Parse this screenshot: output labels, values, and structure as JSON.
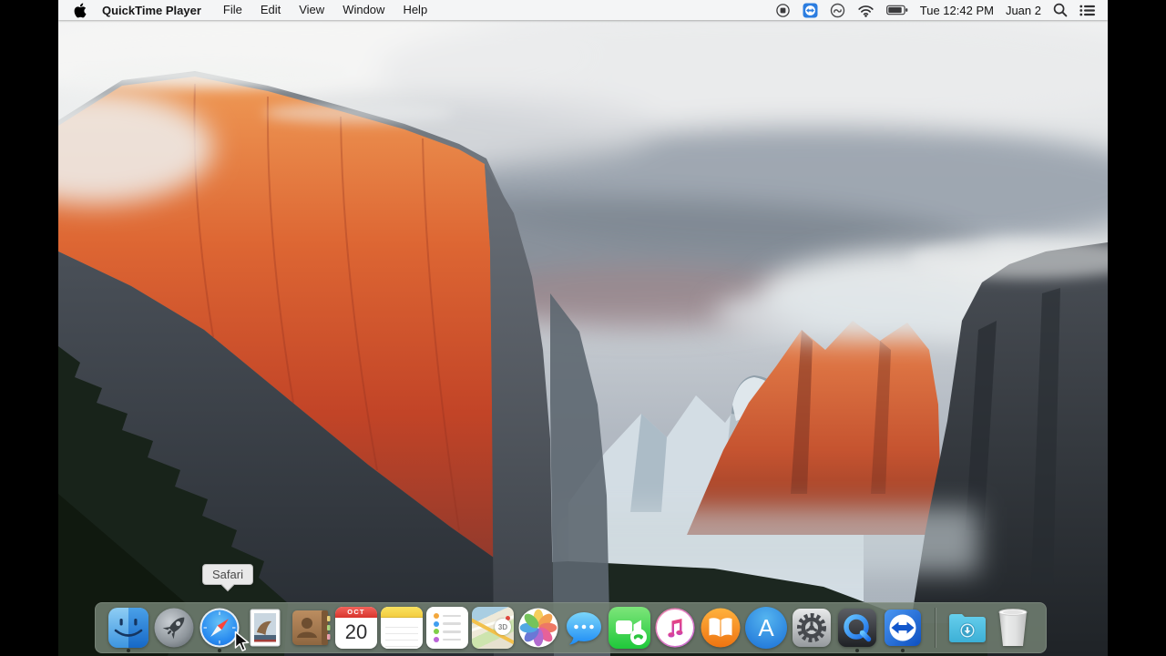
{
  "menu_bar": {
    "app_name": "QuickTime Player",
    "menus": [
      "File",
      "Edit",
      "View",
      "Window",
      "Help"
    ],
    "clock": "Tue 12:42 PM",
    "user_name": "Juan 2",
    "status_icons": [
      "stop-recording-icon",
      "teamviewer-icon",
      "creative-cloud-icon",
      "wifi-icon",
      "battery-icon",
      "spotlight-search-icon",
      "notification-center-icon"
    ],
    "battery_level": 0.85
  },
  "desktop": {
    "wallpaper_name": "os-x-el-capitan-yosemite-valley"
  },
  "tooltip": {
    "text": "Safari"
  },
  "dock": {
    "items": [
      {
        "id": "finder",
        "running": true
      },
      {
        "id": "launchpad",
        "running": false
      },
      {
        "id": "safari",
        "running": true
      },
      {
        "id": "mail",
        "running": false
      },
      {
        "id": "contacts",
        "running": false
      },
      {
        "id": "calendar",
        "running": false
      },
      {
        "id": "notes",
        "running": false
      },
      {
        "id": "reminders",
        "running": false
      },
      {
        "id": "maps",
        "running": false
      },
      {
        "id": "photos",
        "running": false
      },
      {
        "id": "messages",
        "running": false
      },
      {
        "id": "facetime",
        "running": false
      },
      {
        "id": "itunes",
        "running": false
      },
      {
        "id": "ibooks",
        "running": false
      },
      {
        "id": "app-store",
        "running": false
      },
      {
        "id": "system-preferences",
        "running": false
      },
      {
        "id": "quicktime-player",
        "running": true
      },
      {
        "id": "teamviewer",
        "running": true
      },
      {
        "id": "downloads-folder",
        "running": false
      },
      {
        "id": "trash",
        "running": false
      }
    ],
    "calendar_month": "OCT",
    "calendar_day": "20",
    "maps_badge": "3D",
    "app_store_letter": "A"
  },
  "colors": {
    "menubar_bg": "#f7f8f8",
    "dock_bg": "rgba(116,130,116,0.84)",
    "letterbox": "#000000",
    "el_capitan_orange": "#c44427",
    "sky_gray": "#aeb6c0",
    "forest_green": "#18231a"
  }
}
